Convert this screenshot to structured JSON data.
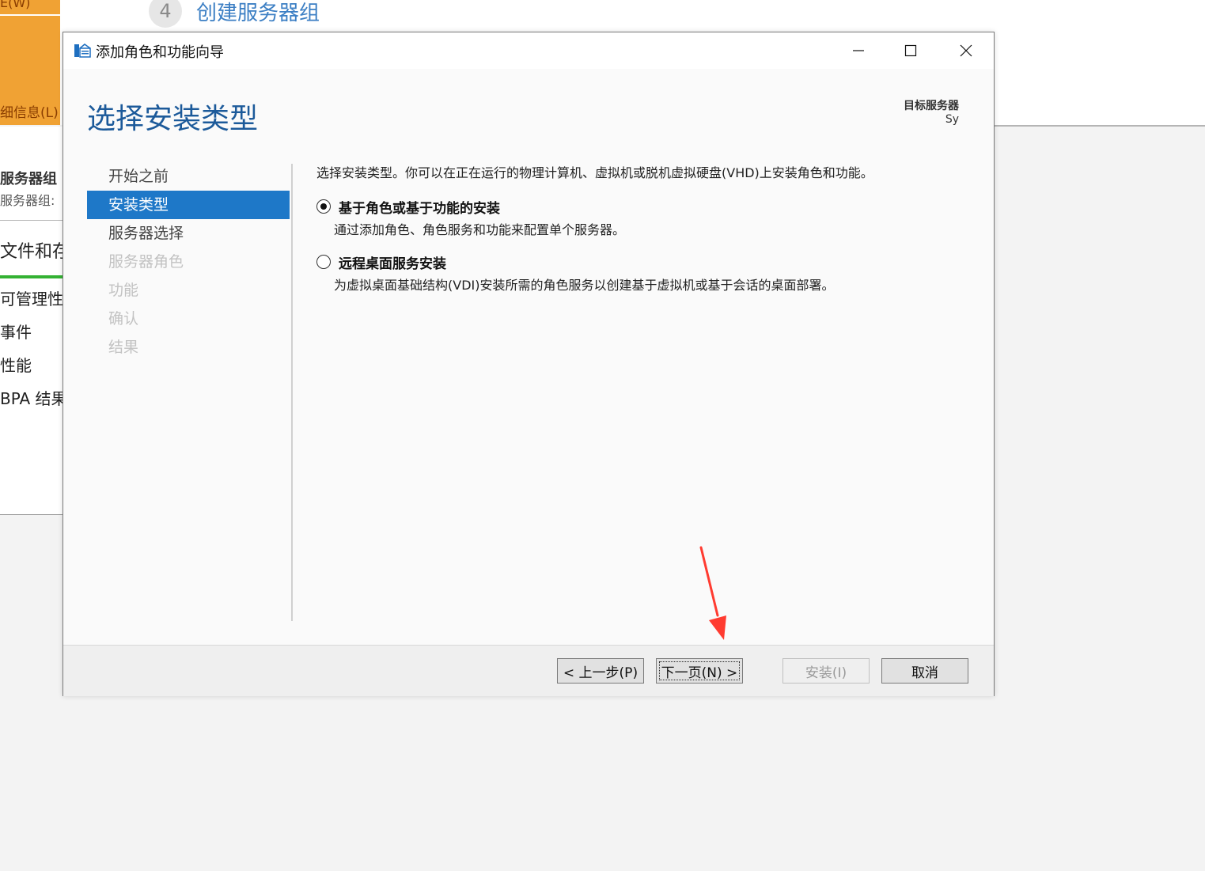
{
  "background": {
    "ribbon_top_text": "E(W)",
    "ribbon_bottom_text": "细信息(L)",
    "step_number": "4",
    "step_title": "创建服务器组",
    "sidebar": {
      "group_title": "服务器组",
      "group_sub": "服务器组:",
      "section_title": "文件和存",
      "items": [
        "可管理性",
        "事件",
        "性能",
        "BPA 结果"
      ]
    }
  },
  "window": {
    "title": "添加角色和功能向导",
    "controls": {
      "minimize": "–",
      "maximize": "□",
      "close": "✕"
    }
  },
  "page": {
    "heading": "选择安装类型",
    "target_server_label": "目标服务器",
    "target_server_value": "Sy"
  },
  "nav": {
    "items": [
      {
        "label": "开始之前",
        "state": "normal"
      },
      {
        "label": "安装类型",
        "state": "active"
      },
      {
        "label": "服务器选择",
        "state": "normal"
      },
      {
        "label": "服务器角色",
        "state": "disabled"
      },
      {
        "label": "功能",
        "state": "disabled"
      },
      {
        "label": "确认",
        "state": "disabled"
      },
      {
        "label": "结果",
        "state": "disabled"
      }
    ]
  },
  "content": {
    "intro": "选择安装类型。你可以在正在运行的物理计算机、虚拟机或脱机虚拟硬盘(VHD)上安装角色和功能。",
    "options": [
      {
        "label": "基于角色或基于功能的安装",
        "description": "通过添加角色、角色服务和功能来配置单个服务器。",
        "selected": true
      },
      {
        "label": "远程桌面服务安装",
        "description": "为虚拟桌面基础结构(VDI)安装所需的角色服务以创建基于虚拟机或基于会话的桌面部署。",
        "selected": false
      }
    ]
  },
  "footer": {
    "prev": "< 上一步(P)",
    "next": "下一页(N) >",
    "install": "安装(I)",
    "cancel": "取消"
  },
  "colors": {
    "accent": "#1e78c8",
    "heading": "#1c5a9a",
    "annotation_arrow": "#ff3b30"
  }
}
